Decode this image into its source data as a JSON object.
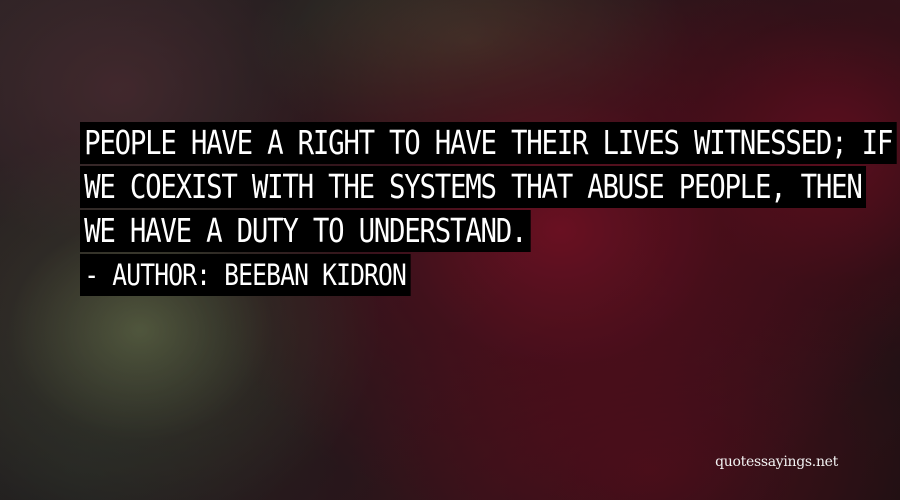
{
  "quote": {
    "lines": [
      "PEOPLE HAVE A RIGHT TO HAVE THEIR LIVES WITNESSED; IF",
      "WE COEXIST WITH THE SYSTEMS THAT ABUSE PEOPLE, THEN",
      "WE HAVE A DUTY TO UNDERSTAND."
    ]
  },
  "author": {
    "line": "- AUTHOR: BEEBAN KIDRON"
  },
  "watermark": {
    "text": "quotessayings.net"
  },
  "colors": {
    "text": "#ffffff",
    "text_background": "#000000"
  }
}
